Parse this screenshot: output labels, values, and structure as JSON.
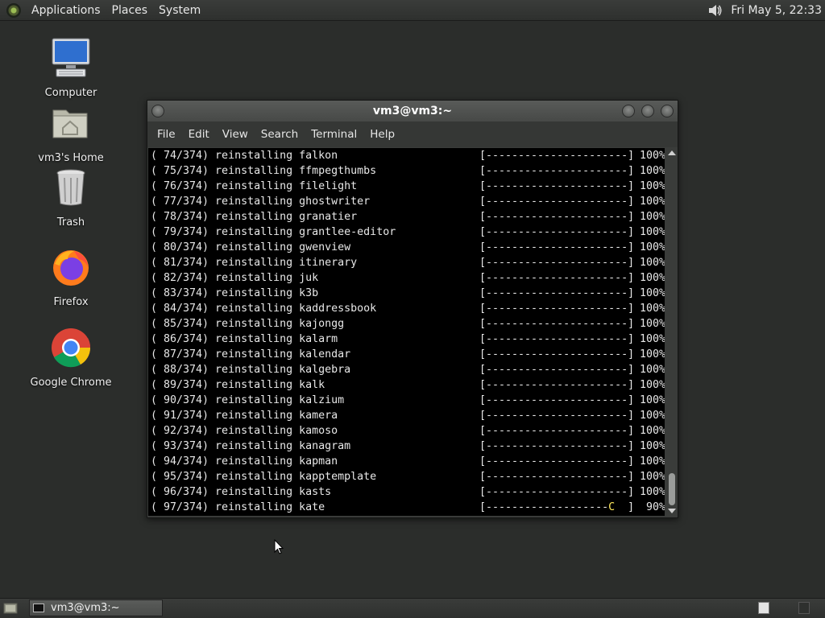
{
  "top_panel": {
    "menus": [
      "Applications",
      "Places",
      "System"
    ],
    "clock": "Fri May  5, 22:33",
    "volume_icon": "speaker-icon"
  },
  "desktop": {
    "icons": [
      {
        "label": "Computer",
        "icon": "computer-icon"
      },
      {
        "label": "vm3's Home",
        "icon": "home-folder-icon"
      },
      {
        "label": "Trash",
        "icon": "trash-icon"
      },
      {
        "label": "Firefox",
        "icon": "firefox-icon"
      },
      {
        "label": "Google Chrome",
        "icon": "chrome-icon"
      }
    ]
  },
  "window": {
    "title": "vm3@vm3:~",
    "menu": [
      "File",
      "Edit",
      "View",
      "Search",
      "Terminal",
      "Help"
    ]
  },
  "terminal": {
    "lines": [
      {
        "n": "( 74/374)",
        "pkg": "falkon",
        "pct": "100%"
      },
      {
        "n": "( 75/374)",
        "pkg": "ffmpegthumbs",
        "pct": "100%"
      },
      {
        "n": "( 76/374)",
        "pkg": "filelight",
        "pct": "100%"
      },
      {
        "n": "( 77/374)",
        "pkg": "ghostwriter",
        "pct": "100%"
      },
      {
        "n": "( 78/374)",
        "pkg": "granatier",
        "pct": "100%"
      },
      {
        "n": "( 79/374)",
        "pkg": "grantlee-editor",
        "pct": "100%"
      },
      {
        "n": "( 80/374)",
        "pkg": "gwenview",
        "pct": "100%"
      },
      {
        "n": "( 81/374)",
        "pkg": "itinerary",
        "pct": "100%"
      },
      {
        "n": "( 82/374)",
        "pkg": "juk",
        "pct": "100%"
      },
      {
        "n": "( 83/374)",
        "pkg": "k3b",
        "pct": "100%"
      },
      {
        "n": "( 84/374)",
        "pkg": "kaddressbook",
        "pct": "100%"
      },
      {
        "n": "( 85/374)",
        "pkg": "kajongg",
        "pct": "100%"
      },
      {
        "n": "( 86/374)",
        "pkg": "kalarm",
        "pct": "100%"
      },
      {
        "n": "( 87/374)",
        "pkg": "kalendar",
        "pct": "100%"
      },
      {
        "n": "( 88/374)",
        "pkg": "kalgebra",
        "pct": "100%"
      },
      {
        "n": "( 89/374)",
        "pkg": "kalk",
        "pct": "100%"
      },
      {
        "n": "( 90/374)",
        "pkg": "kalzium",
        "pct": "100%"
      },
      {
        "n": "( 91/374)",
        "pkg": "kamera",
        "pct": "100%"
      },
      {
        "n": "( 92/374)",
        "pkg": "kamoso",
        "pct": "100%"
      },
      {
        "n": "( 93/374)",
        "pkg": "kanagram",
        "pct": "100%"
      },
      {
        "n": "( 94/374)",
        "pkg": "kapman",
        "pct": "100%"
      },
      {
        "n": "( 95/374)",
        "pkg": "kapptemplate",
        "pct": "100%"
      },
      {
        "n": "( 96/374)",
        "pkg": "kasts",
        "pct": "100%"
      },
      {
        "n": "( 97/374)",
        "pkg": "kate",
        "pct": "90%"
      }
    ],
    "action": "reinstalling",
    "bar_full": "[----------------------]",
    "bar_partial": "[-------------------",
    "bar_cursor": "C",
    "bar_end": "  ]"
  },
  "bottom_panel": {
    "task_label": "vm3@vm3:~"
  }
}
